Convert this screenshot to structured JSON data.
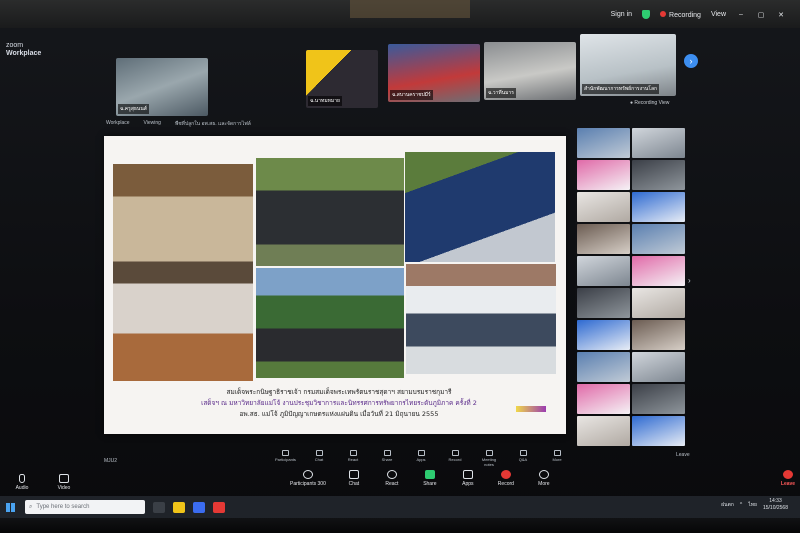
{
  "app": {
    "brand_small": "zoom",
    "brand": "Workplace"
  },
  "top_right": {
    "sign_in": "Sign in",
    "recording": "Recording",
    "view": "View",
    "min": "–",
    "max": "▢",
    "close": "✕"
  },
  "participants": [
    {
      "name": "ฉ.ครูสุธนนส์"
    },
    {
      "name": "ฉ.นาทมหมาย"
    },
    {
      "name": "ฉ.สบานคราชปมีร์"
    },
    {
      "name": "ฉ.วาทีนมาร"
    },
    {
      "name": "สำนักพัฒนาการทรัพย์การงานโลก"
    }
  ],
  "inner_bar": {
    "brand": "Workplace",
    "item1": "Viewing",
    "item2": "พืชที่ปลูกใน อพ.สธ. และจัดการไฟล์"
  },
  "inner_rec": "● Recording   View",
  "slide": {
    "caption_line1": "สมเด็จพระกนิษฐาธิราชเจ้า กรมสมเด็จพระเทพรัตนราชสุดาฯ สยามบรมราชกุมารี",
    "caption_line2": "เสด็จฯ ณ มหาวิทยาลัยแม่โจ้ งานประชุมวิชาการและนิทรรศการทรัพยากรไทยระดับภูมิภาค ครั้งที่ 2",
    "caption_line3": "อพ.สธ. แม่โจ้ ภูมิปัญญาเกษตรแห่งแผ่นดิน เมื่อวันที่ 21 มิถุนายน 2555"
  },
  "inner_left": "MJU2",
  "inner_tools": [
    "Participants",
    "Chat",
    "React",
    "Share",
    "Apps",
    "Record",
    "Meeting notes",
    "Q&A",
    "More"
  ],
  "inner_right": "Leave",
  "toolbar": {
    "audio": "Audio",
    "video": "Video",
    "participants": "Participants",
    "participants_count": "300",
    "chat": "Chat",
    "react": "React",
    "share": "Share",
    "apps": "Apps",
    "record": "Record",
    "more": "More",
    "leave": "Leave"
  },
  "taskbar": {
    "search_placeholder": "Type here to search",
    "weather": "ฝนตก",
    "time": "14:33",
    "date": "15/10/2568",
    "lang": "ไทย"
  },
  "colors": {
    "zoom_blue": "#3d8ef0",
    "share_green": "#2ecc71",
    "leave_red": "#ff5a5a"
  }
}
